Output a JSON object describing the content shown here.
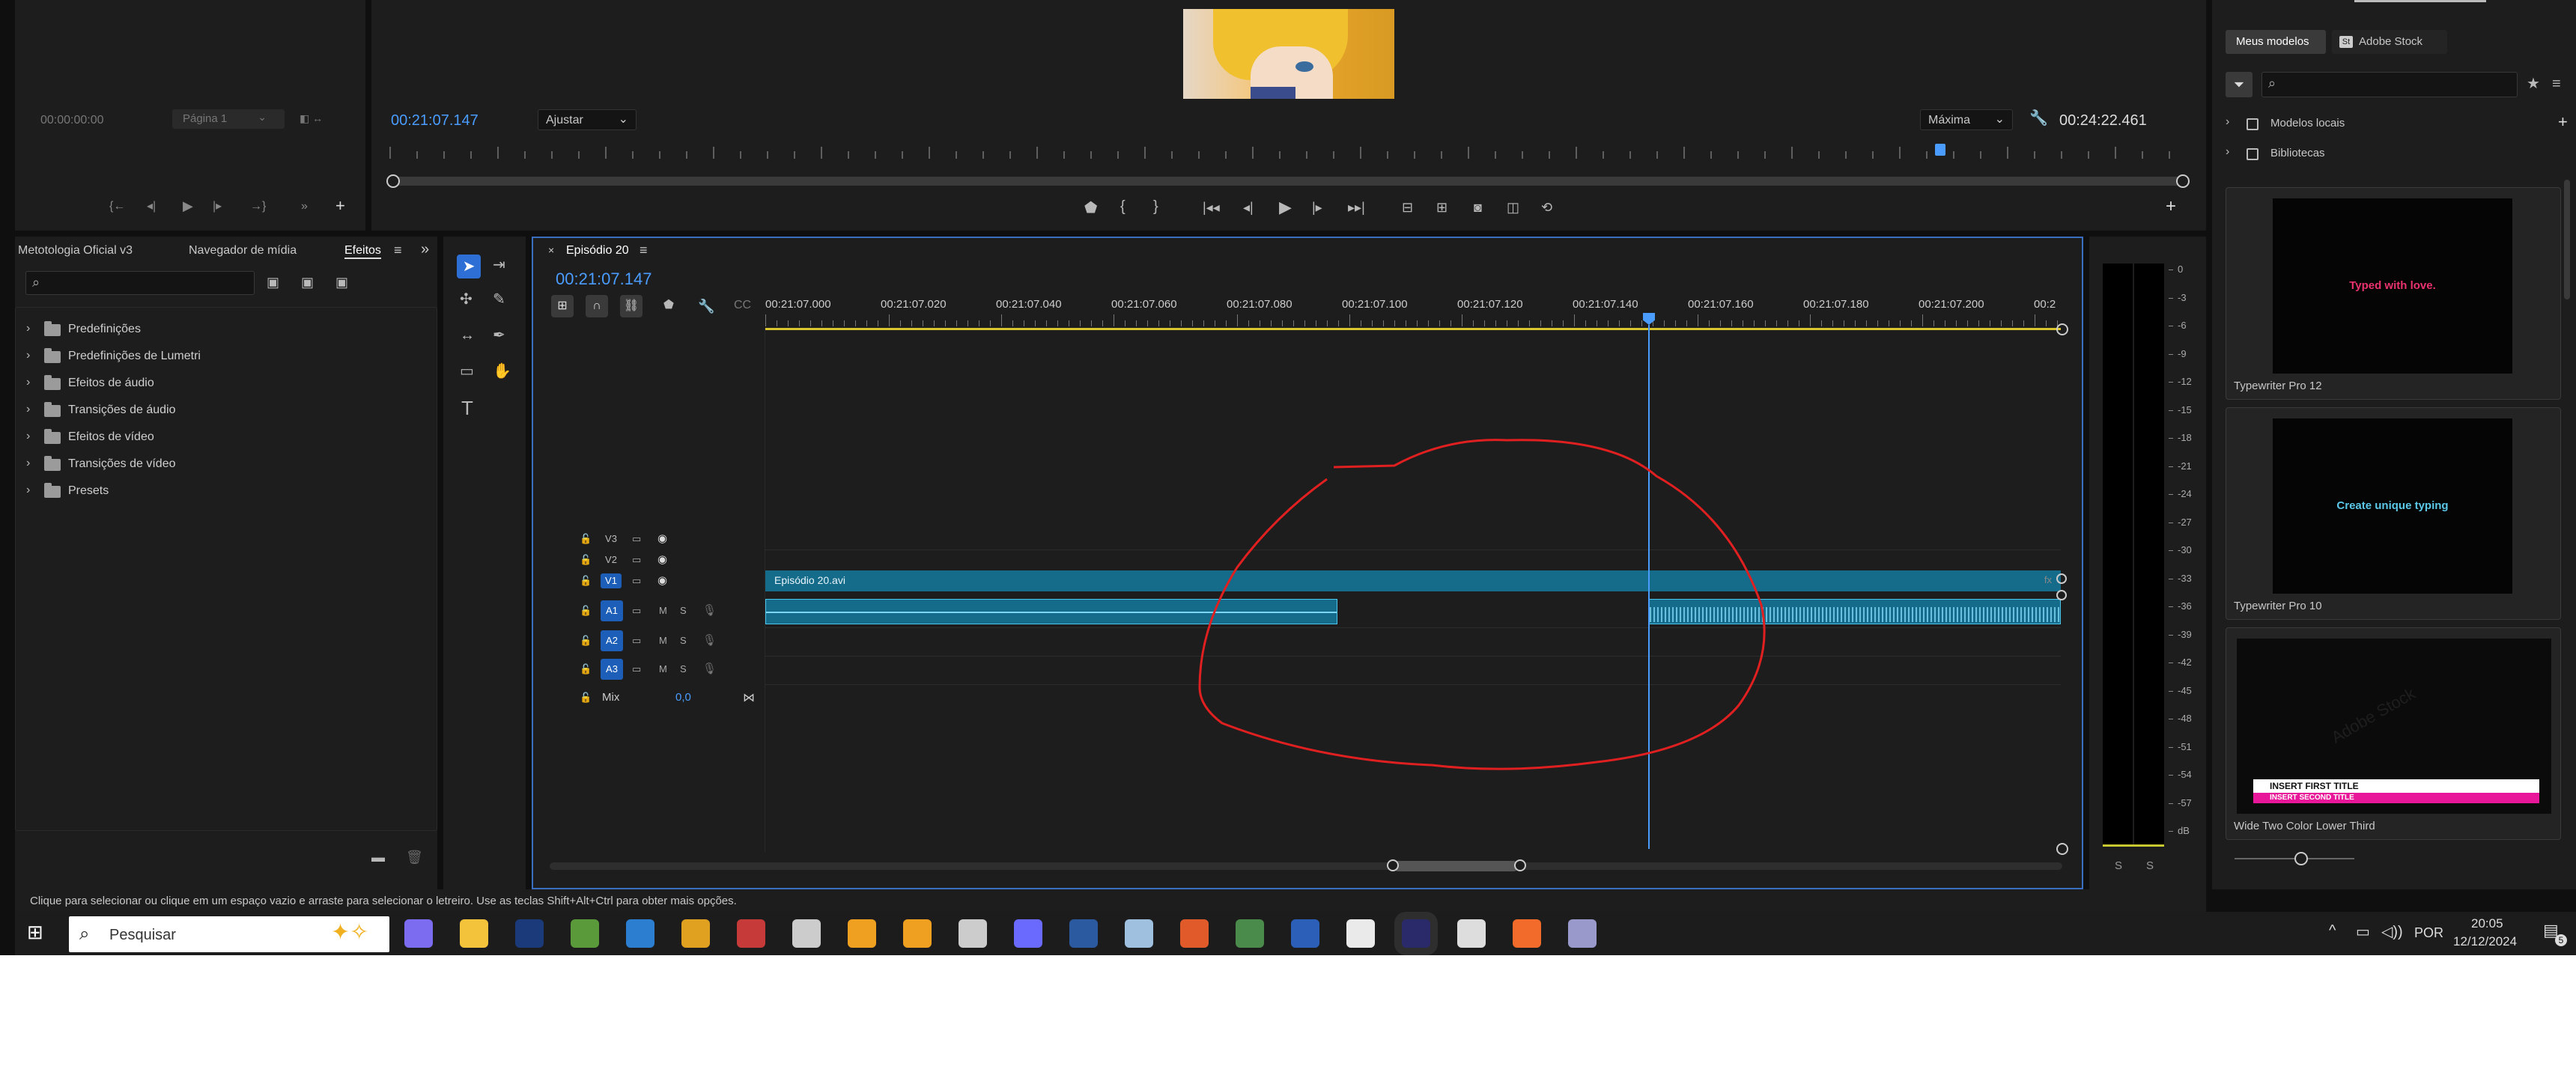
{
  "source_monitor": {
    "timecode": "00:00:00:00",
    "page_select": "Página 1"
  },
  "program_monitor": {
    "timecode": "00:21:07.147",
    "fit_select": "Ajustar",
    "quality_select": "Máxima",
    "duration": "00:24:22.461"
  },
  "effects_panel": {
    "tabs": [
      "Metotologia Oficial v3",
      "Navegador de mídia",
      "Efeitos"
    ],
    "active_tab": "Efeitos",
    "items": [
      "Predefinições",
      "Predefinições de Lumetri",
      "Efeitos de áudio",
      "Transições de áudio",
      "Efeitos de vídeo",
      "Transições de vídeo",
      "Presets"
    ]
  },
  "timeline": {
    "tab_label": "Episódio 20",
    "timecode": "00:21:07.147",
    "ruler": [
      "00:21:07.000",
      "00:21:07.020",
      "00:21:07.040",
      "00:21:07.060",
      "00:21:07.080",
      "00:21:07.100",
      "00:21:07.120",
      "00:21:07.140",
      "00:21:07.160",
      "00:21:07.180",
      "00:21:07.200",
      "00:2"
    ],
    "video_tracks": [
      "V3",
      "V2",
      "V1"
    ],
    "audio_tracks": [
      "A1",
      "A2",
      "A3"
    ],
    "mute_label": "M",
    "solo_label": "S",
    "mix_label": "Mix",
    "mix_value": "0,0",
    "clip_name": "Episódio 20.avi",
    "clip_fx": "fx"
  },
  "audio_meter": {
    "scale": [
      "0",
      "-3",
      "-6",
      "-9",
      "-12",
      "-15",
      "-18",
      "-21",
      "-24",
      "-27",
      "-30",
      "-33",
      "-36",
      "-39",
      "-42",
      "-45",
      "-48",
      "-51",
      "-54",
      "-57",
      "dB"
    ],
    "solo_labels": [
      "S",
      "S"
    ]
  },
  "essential_graphics": {
    "tabs": [
      "Meus modelos",
      "Adobe Stock"
    ],
    "stock_badge": "St",
    "tree": [
      "Modelos locais",
      "Bibliotecas"
    ],
    "templates": [
      {
        "name": "Typewriter Pro 12",
        "preview_text": "Typed with love.",
        "preview_color": "#e8336d"
      },
      {
        "name": "Typewriter Pro 10",
        "preview_text": "Create unique typing",
        "preview_color": "#5bc8e8"
      },
      {
        "name": "Wide Two Color Lower Third",
        "preview_text": "INSERT FIRST TITLE",
        "preview_text_2": "INSERT SECOND TITLE",
        "watermark": "Adobe Stock"
      }
    ]
  },
  "status_bar": {
    "text": "Clique para selecionar ou clique em um espaço vazio e arraste para selecionar o letreiro. Use as teclas Shift+Alt+Ctrl para obter mais opções."
  },
  "taskbar": {
    "search_placeholder": "Pesquisar",
    "language": "POR",
    "time": "20:05",
    "date": "12/12/2024",
    "notification_count": "5",
    "app_icons": [
      "copilot",
      "file-explorer",
      "photoshop",
      "minecraft",
      "photo-viewer",
      "paint",
      "game",
      "aurora",
      "h-app",
      "h-app-2",
      "aurora-2",
      "satellite",
      "bic",
      "folder-app",
      "video-app",
      "calculator",
      "word",
      "chrome",
      "premiere",
      "davinci",
      "firefox",
      "paint-tool"
    ]
  },
  "colors": {
    "accent": "#4a9cff",
    "clip": "#156b8a",
    "annotation": "#e02020",
    "playhead": "#4a9cff",
    "work_area": "#d8c530"
  }
}
